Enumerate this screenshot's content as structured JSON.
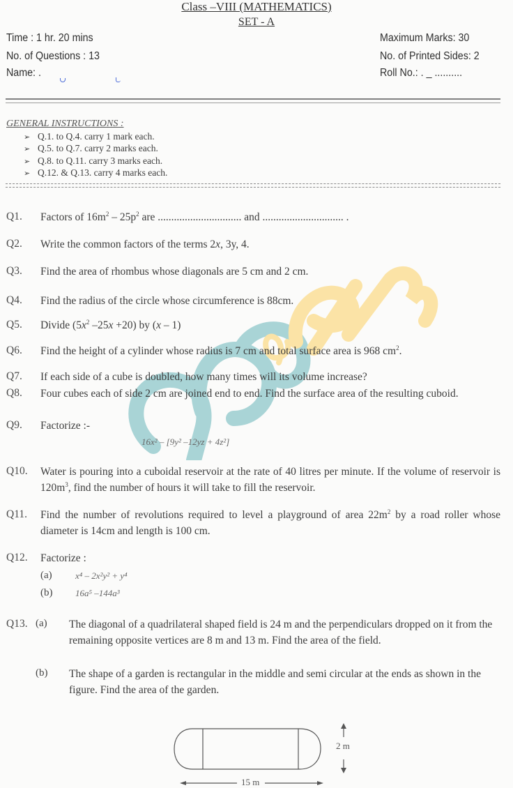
{
  "header": {
    "title": "Class –VIII (MATHEMATICS)",
    "set": "SET - A",
    "time": "Time : 1 hr. 20 mins",
    "num_questions": "No. of Questions : 13",
    "name_label": "Name: .",
    "max_marks": "Maximum Marks:   30",
    "printed_sides": "No. of Printed Sides: 2",
    "roll_no": "Roll No.: .  _ .........."
  },
  "instructions": {
    "heading": "GENERAL INSTRUCTIONS :",
    "bullet_icon": "➢",
    "items": [
      "Q.1. to Q.4. carry 1 mark each.",
      "Q.5. to Q.7. carry 2 marks each.",
      "Q.8. to Q.11. carry 3 marks each.",
      "Q.12. & Q.13. carry 4 marks each."
    ]
  },
  "questions": {
    "q1": {
      "no": "Q1.",
      "pre": "Factors of 16m",
      "sup1": "2",
      "mid": " – 25p",
      "sup2": "2",
      "post": " are ............................... and .............................. ."
    },
    "q2": {
      "no": "Q2.",
      "pre": "Write the common factors of the terms 2",
      "var": "x",
      "post": ", 3y, 4."
    },
    "q3": {
      "no": "Q3.",
      "text": "Find the area of rhombus whose diagonals are 5 cm and 2 cm."
    },
    "q4": {
      "no": "Q4.",
      "text": "Find the radius of the circle whose circumference is 88cm."
    },
    "q5": {
      "no": "Q5.",
      "pre": "Divide  (5",
      "v1": "x",
      "sup": "2",
      "mid": " –25",
      "v2": "x",
      "mid2": " +20) by (",
      "v3": "x",
      "post": " – 1)"
    },
    "q6": {
      "no": "Q6.",
      "pre": "Find the height of a cylinder whose radius is 7 cm and total surface area is 968 cm",
      "sup": "2",
      "post": "."
    },
    "q7": {
      "no": "Q7.",
      "text": "If each side of a cube is doubled, how many times will its volume increase?"
    },
    "q8": {
      "no": "Q8.",
      "text": "Four cubes each of side 2 cm are joined end to end. Find the surface area of the resulting cuboid."
    },
    "q9": {
      "no": "Q9.",
      "text": "Factorize :-",
      "formula": "16x² – [9y² –12yz + 4z²]"
    },
    "q10": {
      "no": "Q10.",
      "pre": "Water is pouring into a cuboidal reservoir at the rate of 40 litres per minute. If the volume of reservoir is 120m",
      "sup": "3",
      "post": ", find the number of hours it will take to fill the reservoir."
    },
    "q11": {
      "no": "Q11.",
      "pre": "Find the number of revolutions required to level a playground of area 22m",
      "sup": "2",
      "post": " by a road roller whose diameter is 14cm and length is 100 cm."
    },
    "q12": {
      "no": "Q12.",
      "text": "Factorize :",
      "parts": [
        {
          "label": "(a)",
          "formula": "x⁴ – 2x²y² + y⁴"
        },
        {
          "label": "(b)",
          "formula": "16a⁵ –144a³"
        }
      ]
    },
    "q13": {
      "no": "Q13.",
      "parts": [
        {
          "label": "(a)",
          "text": "The diagonal of a quadrilateral shaped field is 24 m and the perpendiculars dropped on it from the remaining opposite vertices are 8 m and 13 m. Find the area of the field."
        },
        {
          "label": "(b)",
          "text": "The shape of a garden is rectangular in the middle and semi circular at the ends as shown in the figure. Find the area of the garden."
        }
      ]
    }
  },
  "figure": {
    "width_label": "15 m",
    "height_label": "2 m"
  },
  "watermark": {
    "text": "aglasem",
    "color_primary": "#a9d4d6",
    "color_secondary": "#fbe3a6"
  }
}
